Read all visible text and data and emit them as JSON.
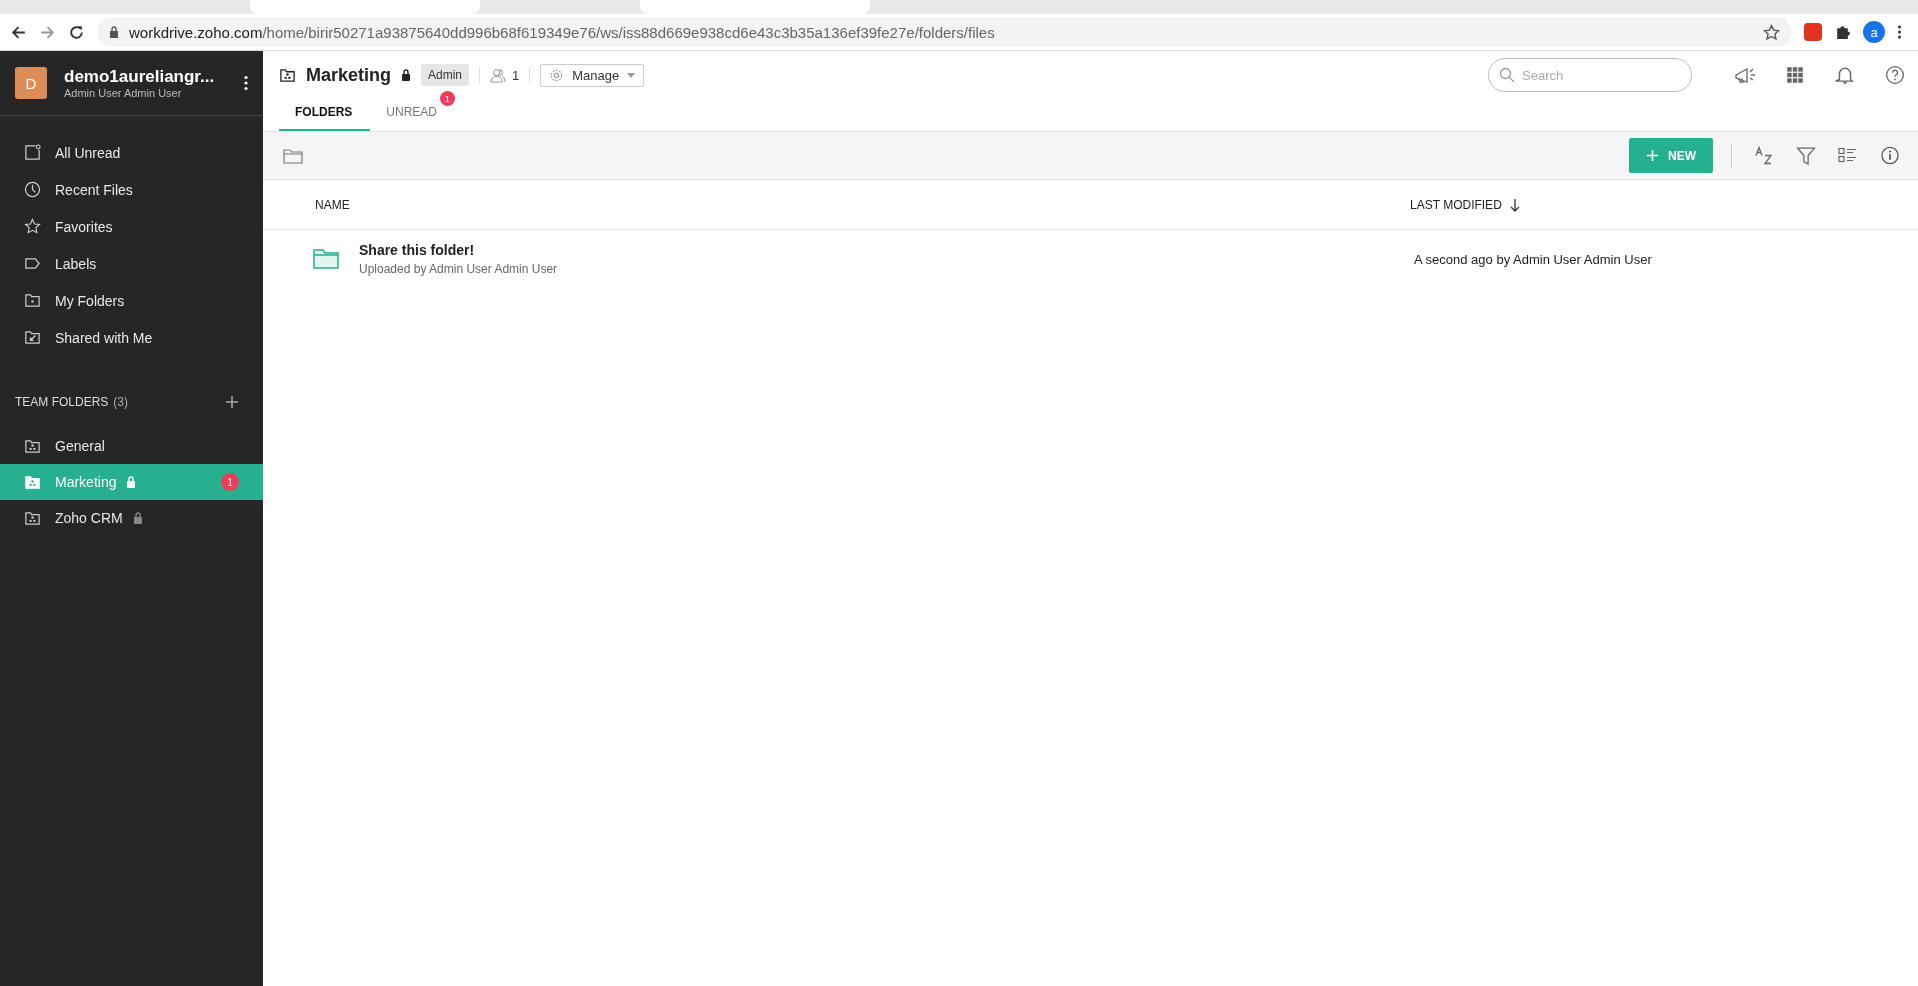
{
  "browser": {
    "url_host": "workdrive.zoho.com",
    "url_path": "/home/birir50271a93875640dd996b68f619349e76/ws/iss88d669e938cd6e43c3b35a136ef39fe27e/folders/files",
    "profile_initial": "a"
  },
  "sidebar": {
    "account": {
      "initial": "D",
      "name": "demo1aureliangr...",
      "subtitle": "Admin User Admin User"
    },
    "nav_items": [
      {
        "label": "All Unread",
        "selected": false
      },
      {
        "label": "Recent Files",
        "selected": false
      },
      {
        "label": "Favorites",
        "selected": false
      },
      {
        "label": "Labels",
        "selected": false
      },
      {
        "label": "My Folders",
        "selected": false
      },
      {
        "label": "Shared with Me",
        "selected": false
      }
    ],
    "team_folders_heading": "TEAM FOLDERS",
    "team_folders_count": "(3)",
    "team_folders": [
      {
        "label": "General",
        "locked": false,
        "selected": false
      },
      {
        "label": "Marketing",
        "locked": true,
        "selected": true,
        "badge": "1"
      },
      {
        "label": "Zoho CRM",
        "locked": true,
        "selected": false
      }
    ]
  },
  "header": {
    "title": "Marketing",
    "locked": true,
    "role": "Admin",
    "members": "1",
    "manage": "Manage",
    "search_placeholder": "Search"
  },
  "tabs": [
    {
      "label": "FOLDERS",
      "selected": true
    },
    {
      "label": "UNREAD",
      "selected": false,
      "badge": "1"
    }
  ],
  "toolbar": {
    "new_button": "NEW"
  },
  "table": {
    "columns": [
      "NAME",
      "LAST MODIFIED"
    ],
    "rows": [
      {
        "name": "Share this folder!",
        "subtitle": "Uploaded by Admin User Admin User",
        "modified": "A second ago by Admin User Admin User"
      }
    ]
  }
}
